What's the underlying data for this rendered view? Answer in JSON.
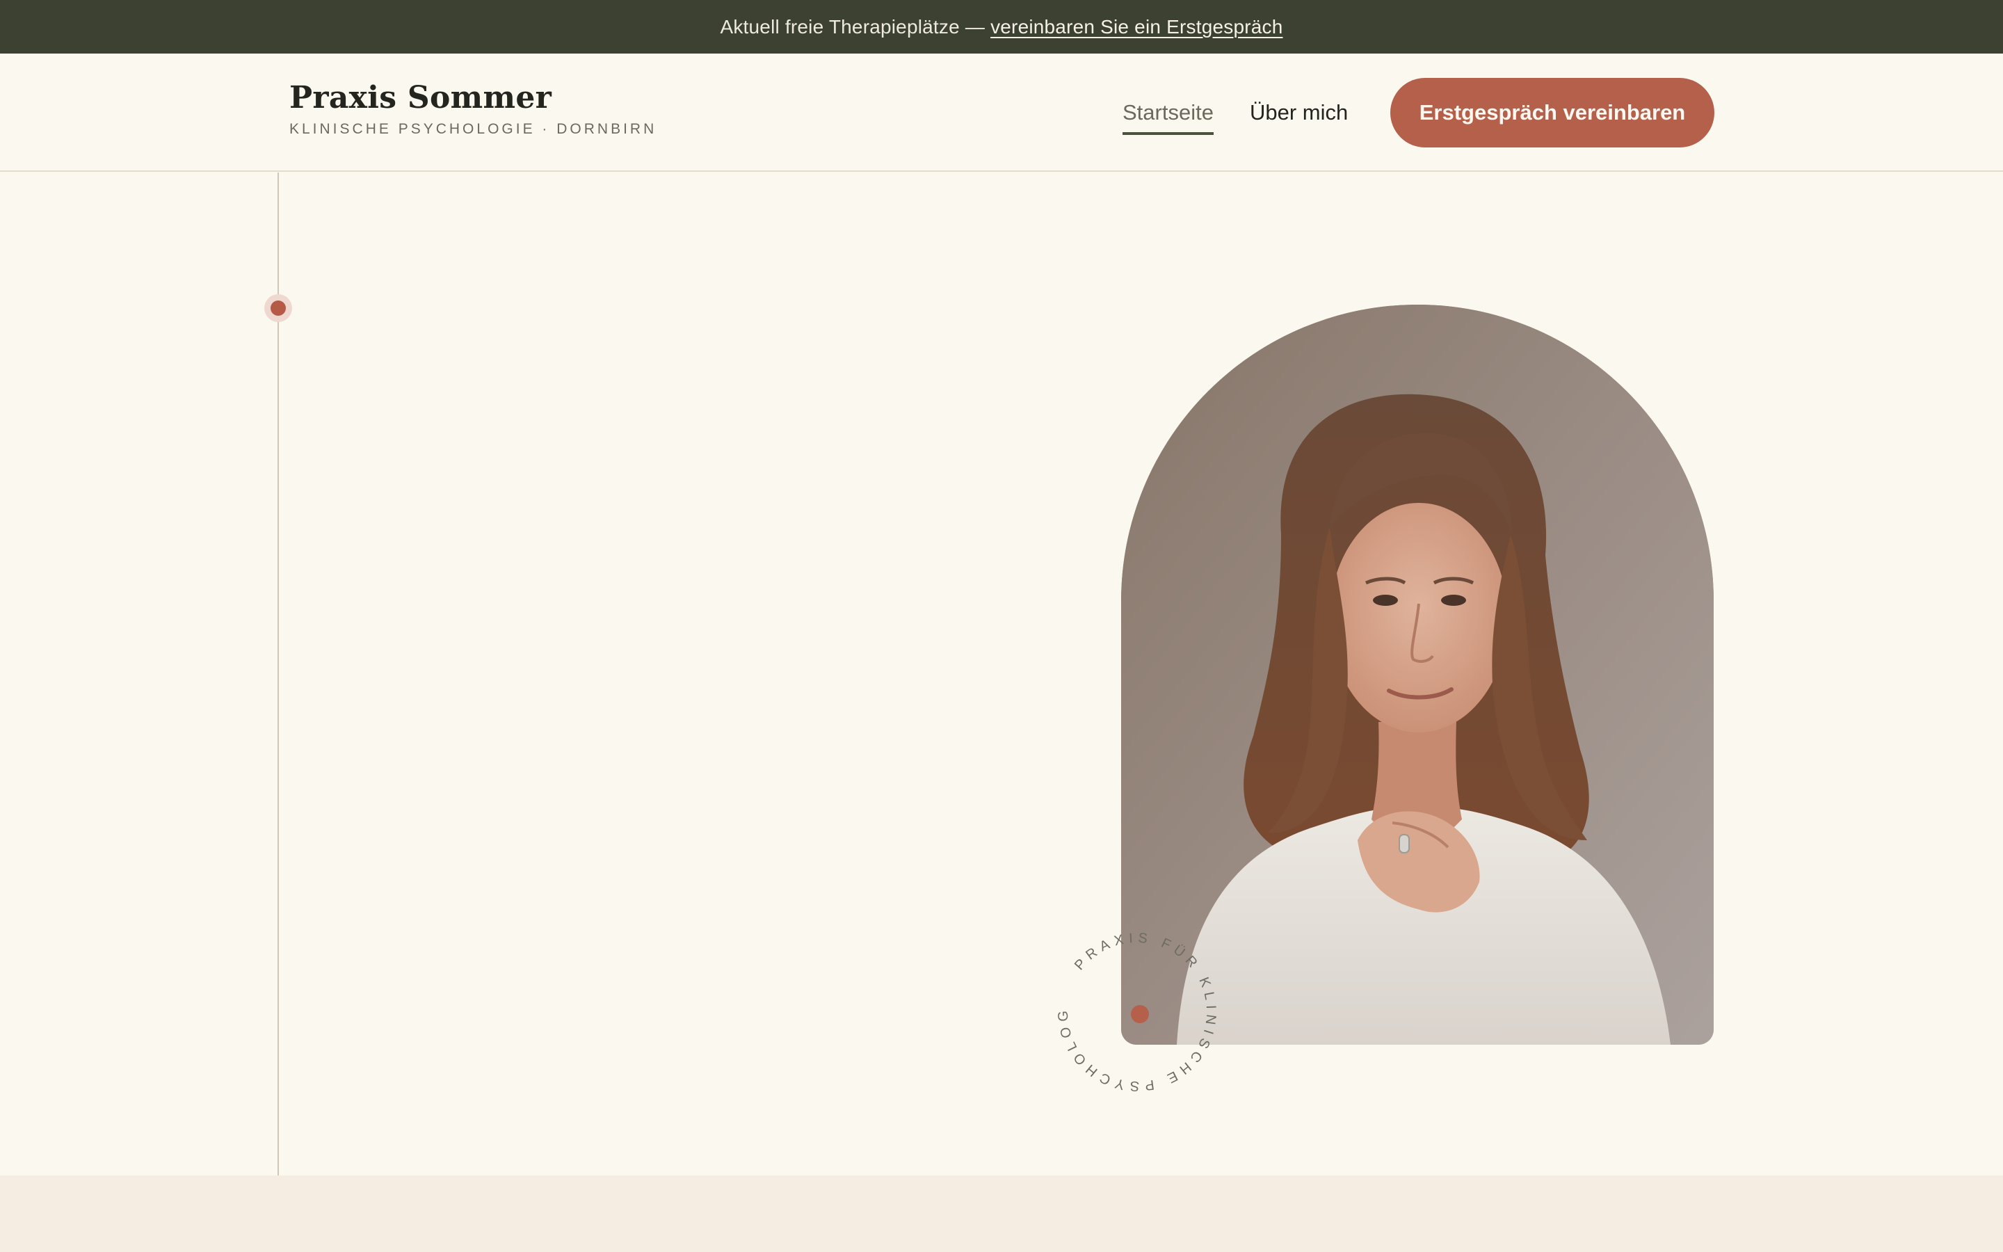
{
  "announcement": {
    "text": "Aktuell freie Therapieplätze",
    "separator": "—",
    "link": "vereinbaren Sie ein Erstgespräch"
  },
  "brand": {
    "title": "Praxis Sommer",
    "subtitle": "KLINISCHE PSYCHOLOGIE · DORNBIRN"
  },
  "nav": {
    "items": [
      {
        "label": "Startseite",
        "active": true
      },
      {
        "label": "Über mich",
        "active": false
      }
    ],
    "cta": "Erstgespräch vereinbaren"
  },
  "badge": {
    "circular_text": "PRAXIS FÜR KLINISCHE PSYCHOLOGIE · CL"
  },
  "colors": {
    "accent": "#b5604b",
    "dark": "#3c4132",
    "background": "#fbf8f0"
  }
}
